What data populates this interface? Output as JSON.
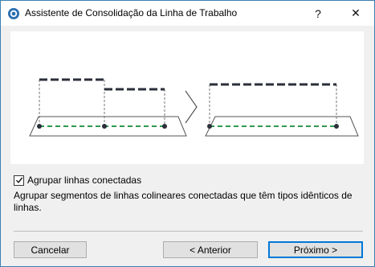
{
  "window": {
    "title": "Assistente de Consolidação da Linha de Trabalho",
    "help_label": "?",
    "close_label": "✕"
  },
  "illustration": {
    "before_icon": "dashed-lines-before-diagram",
    "arrow_icon": "chevron-right-icon",
    "after_icon": "dashed-line-after-diagram"
  },
  "option": {
    "checked": true,
    "label": "Agrupar linhas conectadas"
  },
  "description": "Agrupar segmentos de linhas colineares conectadas que têm tipos idênticos de linhas.",
  "buttons": {
    "cancel": "Cancelar",
    "previous": "< Anterior",
    "next": "Próximo >"
  },
  "colors": {
    "accent": "#0078d7",
    "line_dark": "#2b2f3a",
    "line_green": "#2e9a4e"
  }
}
